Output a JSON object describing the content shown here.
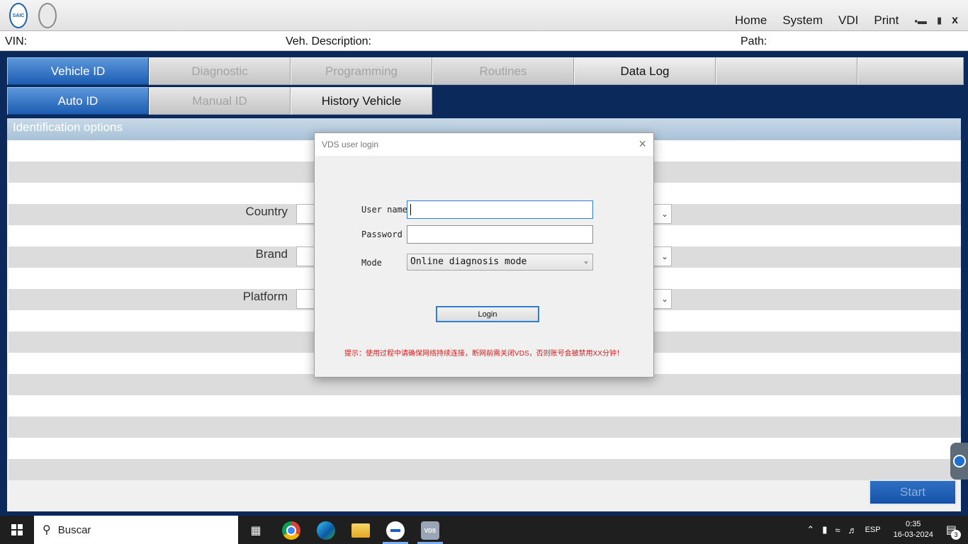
{
  "header": {
    "logos": [
      "SAIC"
    ],
    "nav": [
      "Home",
      "System",
      "VDI",
      "Print"
    ],
    "icons": [
      "signal-icon",
      "plug-icon",
      "close-icon"
    ],
    "close_label": "x"
  },
  "info": {
    "vin_label": "VIN:",
    "vin_value": "",
    "description_label": "Veh. Description:",
    "description_value": "",
    "path_label": "Path:",
    "path_value": ""
  },
  "main_tabs": [
    {
      "label": "Vehicle ID",
      "state": "active"
    },
    {
      "label": "Diagnostic",
      "state": "disabled"
    },
    {
      "label": "Programming",
      "state": "disabled"
    },
    {
      "label": "Routines",
      "state": "disabled"
    },
    {
      "label": "Data Log",
      "state": "enabled"
    },
    {
      "label": "",
      "state": "blank"
    },
    {
      "label": "",
      "state": "blank"
    }
  ],
  "sub_tabs": [
    {
      "label": "Auto ID",
      "state": "active"
    },
    {
      "label": "Manual ID",
      "state": "disabled"
    },
    {
      "label": "History Vehicle",
      "state": "enabled"
    }
  ],
  "panel": {
    "title": "Identification options",
    "fields": [
      {
        "label": "Country",
        "value": ""
      },
      {
        "label": "Brand",
        "value": ""
      },
      {
        "label": "Platform",
        "value": ""
      }
    ],
    "start_label": "Start"
  },
  "dialog": {
    "title": "VDS user login",
    "username_label": "User name",
    "username_value": "",
    "password_label": "Password",
    "password_value": "",
    "mode_label": "Mode",
    "mode_value": "Online diagnosis mode",
    "login_label": "Login",
    "note": "提示：使用过程中请确保网络持续连接，断网前需关闭VDS，否则账号会被禁用XX分钟！"
  },
  "taskbar": {
    "search_label": "Buscar",
    "apps": [
      "task-view-icon",
      "chrome-icon",
      "edge-icon",
      "file-explorer-icon",
      "teamviewer-icon",
      "vds-icon"
    ],
    "language": "ESP",
    "time": "0:35",
    "date": "16-03-2024",
    "notifications": "3"
  }
}
